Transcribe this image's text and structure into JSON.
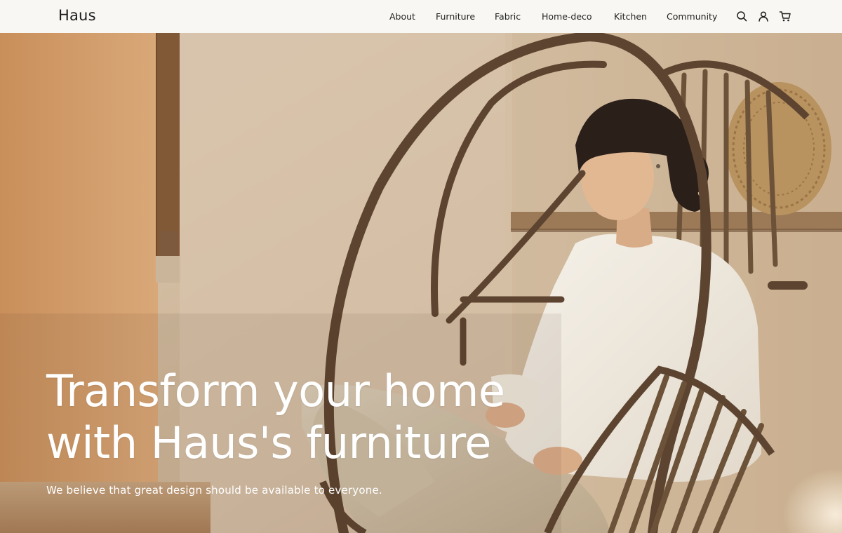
{
  "header": {
    "logo": "Haus",
    "nav": [
      "About",
      "Furniture",
      "Fabric",
      "Home-deco",
      "Kitchen",
      "Community"
    ],
    "icons": [
      "search-icon",
      "user-icon",
      "cart-icon"
    ]
  },
  "hero": {
    "headline_line1": "Transform your home",
    "headline_line2": "with Haus's furniture",
    "subtitle": "We believe that great design should be available to everyone."
  },
  "colors": {
    "header_bg": "#f8f7f3",
    "text_dark": "#1f1f1f",
    "hero_text": "#ffffff",
    "wall_warm": "#c4946a",
    "wall_light": "#dcc8b0"
  }
}
